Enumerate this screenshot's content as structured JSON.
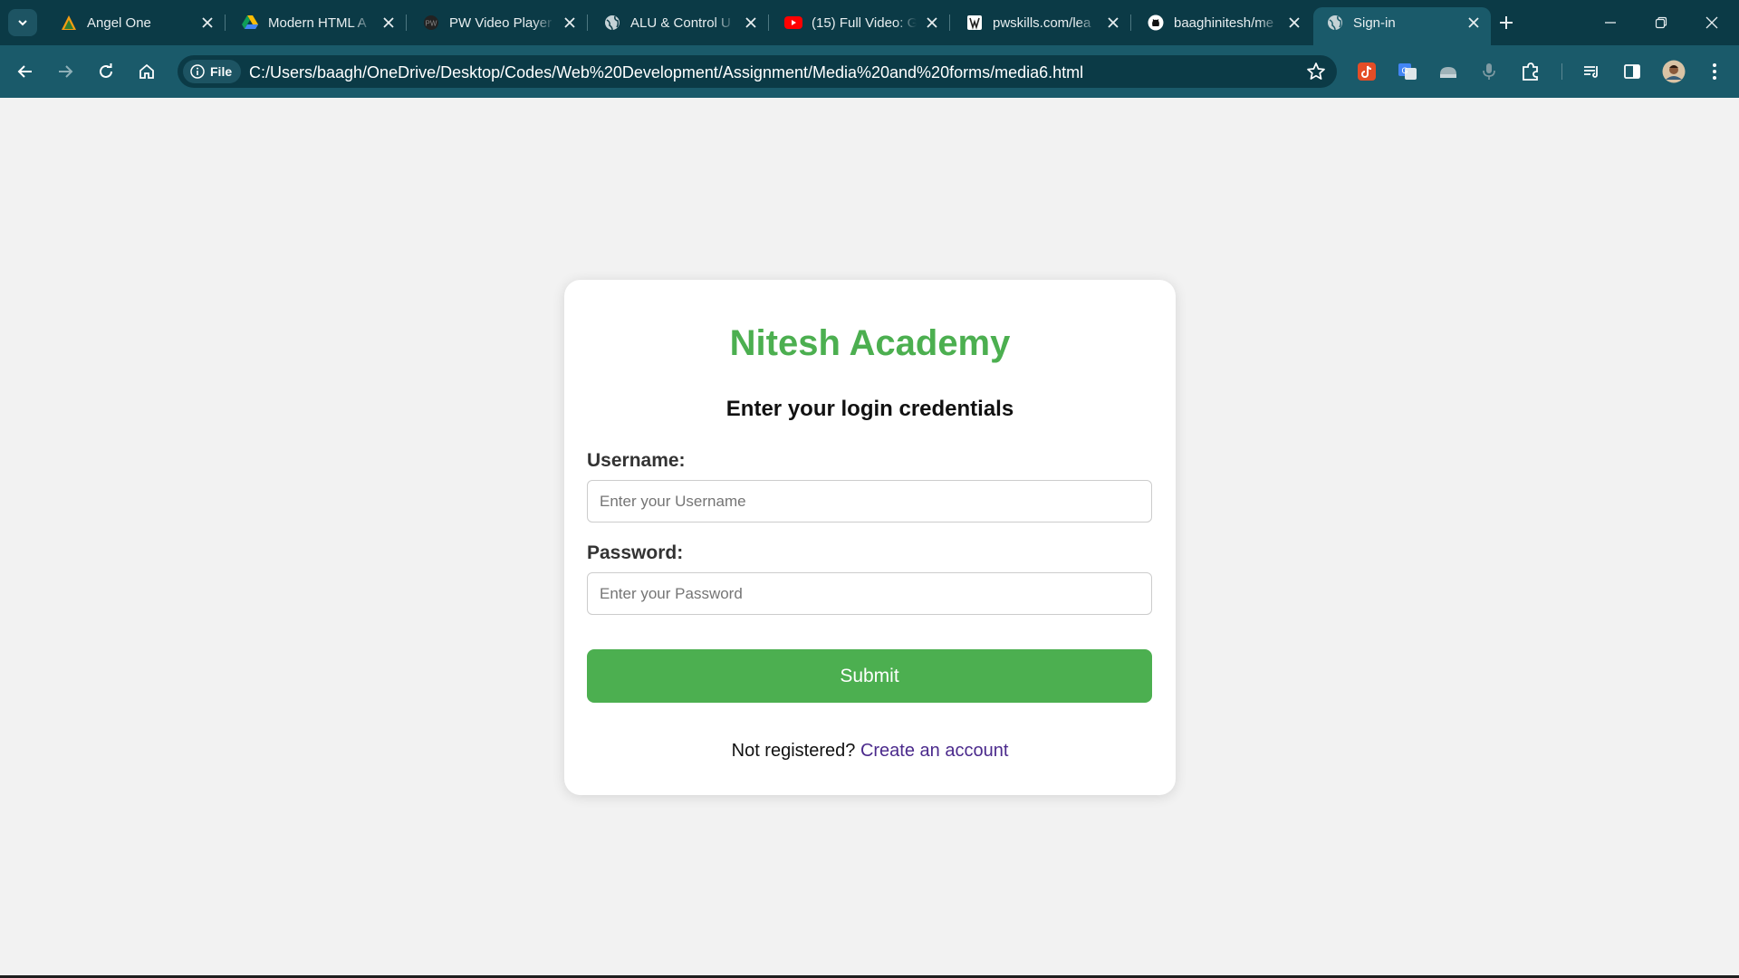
{
  "browser": {
    "tabs": [
      {
        "title": "Angel One",
        "icon": "angel-one-icon",
        "active": false
      },
      {
        "title": "Modern HTML A",
        "icon": "google-drive-icon",
        "active": false
      },
      {
        "title": "PW Video Player",
        "icon": "pw-icon",
        "active": false
      },
      {
        "title": "ALU & Control U",
        "icon": "globe-icon",
        "active": false
      },
      {
        "title": "(15) Full Video: G",
        "icon": "youtube-icon",
        "active": false
      },
      {
        "title": "pwskills.com/lea",
        "icon": "pwskills-icon",
        "active": false
      },
      {
        "title": "baaghinitesh/me",
        "icon": "github-icon",
        "active": false
      },
      {
        "title": "Sign-in",
        "icon": "globe-icon",
        "active": true
      }
    ],
    "file_chip_label": "File",
    "url": "C:/Users/baagh/OneDrive/Desktop/Codes/Web%20Development/Assignment/Media%20and%20forms/media6.html"
  },
  "page": {
    "brand": "Nitesh Academy",
    "subtitle": "Enter your login credentials",
    "username_label": "Username:",
    "username_placeholder": "Enter your Username",
    "password_label": "Password:",
    "password_placeholder": "Enter your Password",
    "submit_label": "Submit",
    "footer_text": "Not registered?",
    "footer_link": "Create an account"
  },
  "colors": {
    "brand_green": "#4caf50",
    "link_purple": "#4b2a8c",
    "chrome_dark": "#0b3a46",
    "chrome_toolbar": "#1a5a6a"
  }
}
